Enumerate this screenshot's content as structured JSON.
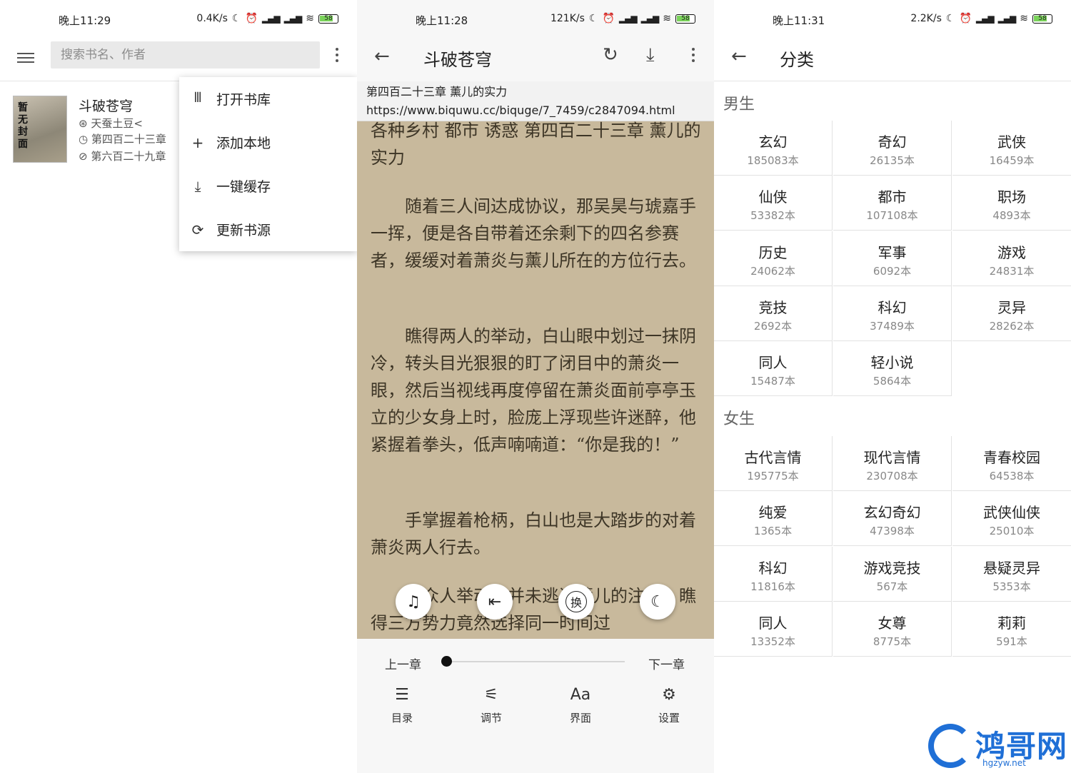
{
  "panel1": {
    "status": {
      "time": "晚上11:29",
      "speed": "0.4K/s",
      "battery": "58"
    },
    "search": {
      "placeholder": "搜索书名、作者"
    },
    "book": {
      "cover_text": "暂无封面",
      "title": "斗破苍穹",
      "author": "天蚕土豆<",
      "current_chapter": "第四百二十三章",
      "latest_chapter": "第六百二十九章"
    },
    "menu": [
      {
        "label": "打开书库",
        "icon": "library-icon"
      },
      {
        "label": "添加本地",
        "icon": "plus-icon"
      },
      {
        "label": "一键缓存",
        "icon": "download-icon"
      },
      {
        "label": "更新书源",
        "icon": "refresh-icon"
      }
    ]
  },
  "panel2": {
    "status": {
      "time": "晚上11:28",
      "speed": "121K/s",
      "battery": "58"
    },
    "title": "斗破苍穹",
    "chapter_title": "第四百二十三章 薰儿的实力",
    "chapter_url": "https://www.biquwu.cc/biquge/7_7459/c2847094.html",
    "paragraphs": [
      "各种乡村 都市 诱惑 第四百二十三章 薰儿的实力",
      "　　随着三人间达成协议，那吴昊与琥嘉手一挥，便是各自带着还余剩下的四名参赛者，缓缓对着萧炎与薰儿所在的方位行去。",
      "　　瞧得两人的举动，白山眼中划过一抹阴冷，转头目光狠狠的盯了闭目中的萧炎一眼，然后当视线再度停留在萧炎面前亭亭玉立的少女身上时，脸庞上浮现些许迷醉，他紧握着拳头，低声喃喃道：“你是我的！”",
      "　　手掌握着枪柄，白山也是大踏步的对着萧炎两人行去。",
      "　　中众人举动，并未逃过薰儿的注意，瞧得三方势力竟然选择同一时间过"
    ],
    "fabs": [
      "headphones-icon",
      "exit-icon",
      "swap-source-icon",
      "night-mode-icon"
    ],
    "fab_swap_text": "换",
    "prev_label": "上一章",
    "next_label": "下一章",
    "progress": 0,
    "nav": [
      {
        "label": "目录",
        "icon": "list-icon"
      },
      {
        "label": "调节",
        "icon": "sliders-icon"
      },
      {
        "label": "界面",
        "icon": "font-icon"
      },
      {
        "label": "设置",
        "icon": "gear-icon"
      }
    ]
  },
  "panel3": {
    "status": {
      "time": "晚上11:31",
      "speed": "2.2K/s",
      "battery": "58"
    },
    "title": "分类",
    "male_label": "男生",
    "female_label": "女生",
    "male": [
      {
        "name": "玄幻",
        "count": "185083本"
      },
      {
        "name": "奇幻",
        "count": "26135本"
      },
      {
        "name": "武侠",
        "count": "16459本"
      },
      {
        "name": "仙侠",
        "count": "53382本"
      },
      {
        "name": "都市",
        "count": "107108本"
      },
      {
        "name": "职场",
        "count": "4893本"
      },
      {
        "name": "历史",
        "count": "24062本"
      },
      {
        "name": "军事",
        "count": "6092本"
      },
      {
        "name": "游戏",
        "count": "24831本"
      },
      {
        "name": "竞技",
        "count": "2692本"
      },
      {
        "name": "科幻",
        "count": "37489本"
      },
      {
        "name": "灵异",
        "count": "28262本"
      },
      {
        "name": "同人",
        "count": "15487本"
      },
      {
        "name": "轻小说",
        "count": "5864本"
      }
    ],
    "female": [
      {
        "name": "古代言情",
        "count": "195775本"
      },
      {
        "name": "现代言情",
        "count": "230708本"
      },
      {
        "name": "青春校园",
        "count": "64538本"
      },
      {
        "name": "纯爱",
        "count": "1365本"
      },
      {
        "name": "玄幻奇幻",
        "count": "47398本"
      },
      {
        "name": "武侠仙侠",
        "count": "25010本"
      },
      {
        "name": "科幻",
        "count": "11816本"
      },
      {
        "name": "游戏竞技",
        "count": "567本"
      },
      {
        "name": "悬疑灵异",
        "count": "5353本"
      },
      {
        "name": "同人",
        "count": "13352本"
      },
      {
        "name": "女尊",
        "count": "8775本"
      },
      {
        "name": "莉莉",
        "count": "591本"
      }
    ]
  },
  "watermark": {
    "name": "鸿哥网",
    "domain": "hgzyw.net",
    "color": "#1f6fd6"
  }
}
